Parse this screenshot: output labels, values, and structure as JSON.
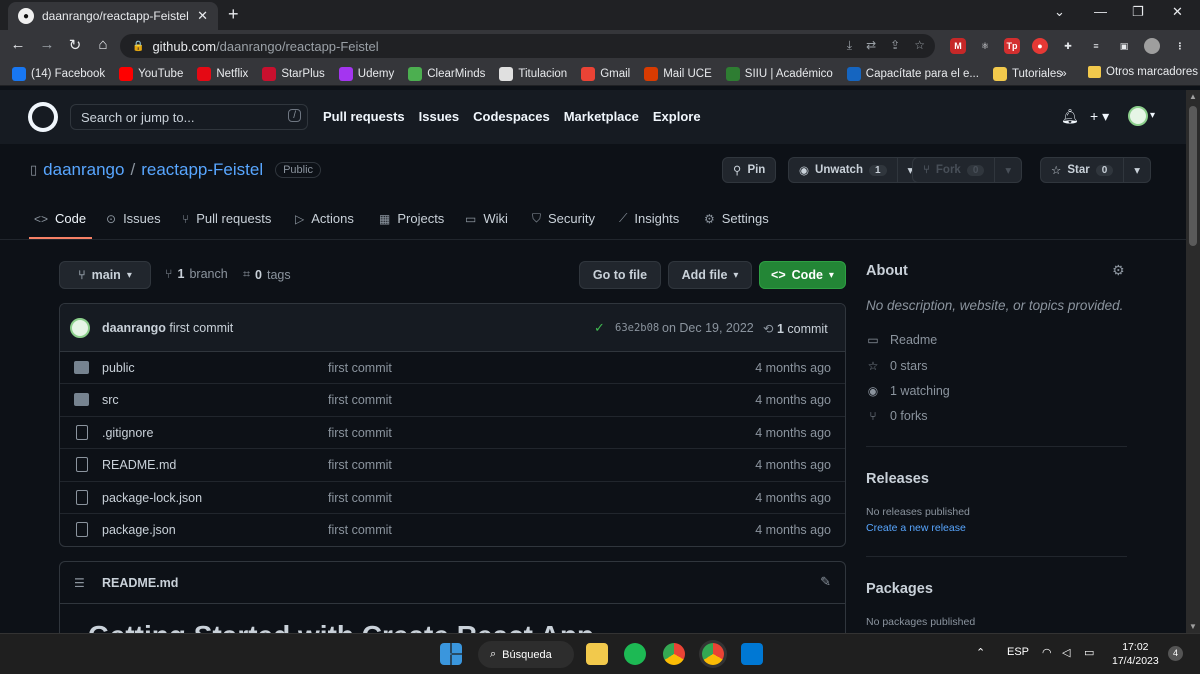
{
  "browser": {
    "tab_title": "daanrango/reactapp-Feistel",
    "tab_close": "✕",
    "new_tab": "+",
    "url_host": "github.com",
    "url_path": "/daanrango/reactapp-Feistel",
    "window_controls": [
      "⌄",
      "—",
      "❐",
      "✕"
    ],
    "bookmarks": [
      {
        "label": "(14) Facebook",
        "color": "#1877f2"
      },
      {
        "label": "YouTube",
        "color": "#ff0000"
      },
      {
        "label": "Netflix",
        "color": "#e50914"
      },
      {
        "label": "StarPlus",
        "color": "#c8102e"
      },
      {
        "label": "Udemy",
        "color": "#a435f0"
      },
      {
        "label": "ClearMinds",
        "color": "#4caf50"
      },
      {
        "label": "Titulacion",
        "color": "#e0e0e0"
      },
      {
        "label": "Gmail",
        "color": "#ea4335"
      },
      {
        "label": "Mail UCE",
        "color": "#d83b01"
      },
      {
        "label": "SIIU | Académico",
        "color": "#2e7d32"
      },
      {
        "label": "Capacítate para el e...",
        "color": "#1565c0"
      },
      {
        "label": "Tutoriales",
        "color": "#f2c94c"
      }
    ],
    "more_bookmarks": "»",
    "other_bookmarks": "Otros marcadores"
  },
  "header": {
    "search_placeholder": "Search or jump to...",
    "search_key": "/",
    "nav": [
      "Pull requests",
      "Issues",
      "Codespaces",
      "Marketplace",
      "Explore"
    ]
  },
  "repo": {
    "owner": "daanrango",
    "separator": "/",
    "name": "reactapp-Feistel",
    "visibility": "Public",
    "pin_label": "Pin",
    "unwatch_label": "Unwatch",
    "watch_count": "1",
    "fork_label": "Fork",
    "fork_count": "0",
    "star_label": "Star",
    "star_count": "0"
  },
  "tabs": [
    "Code",
    "Issues",
    "Pull requests",
    "Actions",
    "Projects",
    "Wiki",
    "Security",
    "Insights",
    "Settings"
  ],
  "controls": {
    "branch": "main",
    "branches_count": "1",
    "branches_label": "branch",
    "tags_count": "0",
    "tags_label": "tags",
    "go_to_file": "Go to file",
    "add_file": "Add file",
    "code": "Code"
  },
  "latest_commit": {
    "author": "daanrango",
    "message": "first commit",
    "sha": "63e2b08",
    "date": "on Dec 19, 2022",
    "commit_count": "1",
    "commit_label": "commit"
  },
  "files": [
    {
      "name": "public",
      "type": "folder",
      "message": "first commit",
      "time": "4 months ago"
    },
    {
      "name": "src",
      "type": "folder",
      "message": "first commit",
      "time": "4 months ago"
    },
    {
      "name": ".gitignore",
      "type": "file",
      "message": "first commit",
      "time": "4 months ago"
    },
    {
      "name": "README.md",
      "type": "file",
      "message": "first commit",
      "time": "4 months ago"
    },
    {
      "name": "package-lock.json",
      "type": "file",
      "message": "first commit",
      "time": "4 months ago"
    },
    {
      "name": "package.json",
      "type": "file",
      "message": "first commit",
      "time": "4 months ago"
    }
  ],
  "readme": {
    "filename": "README.md",
    "heading": "Getting Started with Create React App"
  },
  "about": {
    "title": "About",
    "description": "No description, website, or topics provided.",
    "readme": "Readme",
    "stars": "0 stars",
    "watching": "1 watching",
    "forks": "0 forks"
  },
  "releases": {
    "title": "Releases",
    "none": "No releases published",
    "create": "Create a new release"
  },
  "packages": {
    "title": "Packages",
    "none": "No packages published"
  },
  "taskbar": {
    "search": "Búsqueda",
    "lang": "ESP",
    "time": "17:02",
    "date": "17/4/2023",
    "notifications": "4"
  },
  "colors": {
    "bg": "#0d1117",
    "header": "#161b22",
    "accent_link": "#58a6ff",
    "code_button": "#238636",
    "tab_underline": "#f78166"
  }
}
